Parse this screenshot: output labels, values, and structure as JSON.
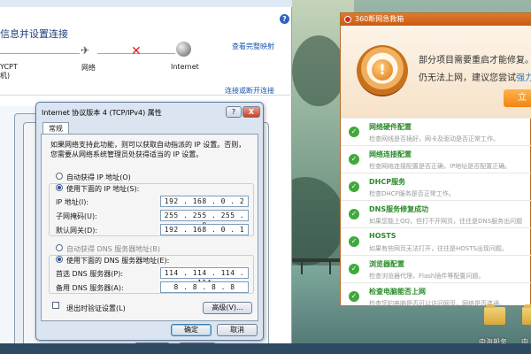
{
  "network_center": {
    "title": "信息并设置连接",
    "full_map_link": "查看完整映射",
    "computer_label_line1": "YCPT",
    "computer_label_line2": "机)",
    "network_label": "网络",
    "internet_label": "Internet",
    "connect_link": "连接或断开连接",
    "help_icon": "?"
  },
  "tcp_dialog": {
    "title": "Internet 协议版本 4 (TCP/IPv4) 属性",
    "help_button": "?",
    "close_button": "X",
    "tab_general": "常规",
    "info_text": "如果网络支持此功能，则可以获取自动指派的 IP 设置。否则，您需要从网络系统管理员处获得适当的 IP 设置。",
    "auto_ip_label": "自动获得 IP 地址(O)",
    "manual_ip_label": "使用下面的 IP 地址(S):",
    "ip_label": "IP 地址(I):",
    "ip_value": "192 . 168 . 0 . 2",
    "mask_label": "子网掩码(U):",
    "mask_value": "255 . 255 . 255 . 0",
    "gateway_label": "默认网关(D):",
    "gateway_value": "192 . 168 . 0 . 1",
    "auto_dns_label": "自动获得 DNS 服务器地址(B)",
    "manual_dns_label": "使用下面的 DNS 服务器地址(E):",
    "dns1_label": "首选 DNS 服务器(P):",
    "dns1_value": "114 . 114 . 114 . 114",
    "dns2_label": "备用 DNS 服务器(A):",
    "dns2_value": "8 . 8 . 8 . 8",
    "validate_label": "退出时验证设置(L)",
    "advanced_button": "高级(V)...",
    "ok_button": "确定",
    "cancel_button": "取消"
  },
  "back_dialog": {
    "ok_button": "确定",
    "cancel_button": "取消"
  },
  "repair_panel": {
    "title": "360断网急救箱",
    "banner_line1": "部分项目需要重启才能修复。",
    "banner_line2_prefix": "仍无法上网，建议您尝试",
    "banner_line2_link": "强力",
    "repair_button": "立",
    "items": [
      {
        "title": "网络硬件配置",
        "desc": "检查网线是否插好，网卡及驱动是否正常工作。"
      },
      {
        "title": "网络连接配置",
        "desc": "检查网络连接配置是否正确，IP地址是否配置正确。"
      },
      {
        "title": "DHCP服务",
        "desc": "检查DHCP服务是否正常工作。"
      },
      {
        "title": "DNS服务修复成功",
        "desc": "如果您能上QQ，但打不开网页，往往是DNS服务出问题"
      },
      {
        "title": "HOSTS",
        "desc": "如果有些网页无法打开，往往是HOSTS出现问题。"
      },
      {
        "title": "浏览器配置",
        "desc": "检查浏览器代理，Flash插件等配置问题。"
      },
      {
        "title": "检查电脑能否上网",
        "desc": "检查您的电脑是否可以访问网页，网络是否连通。"
      }
    ]
  },
  "desktop": {
    "icon1_label": "中海船务",
    "icon2_label": "中"
  }
}
